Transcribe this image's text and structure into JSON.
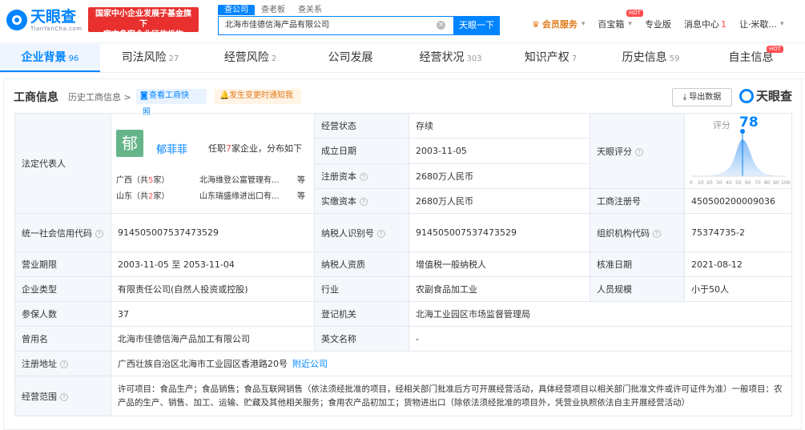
{
  "header": {
    "logo_name": "天眼查",
    "logo_sub": "TianYanCha.com",
    "red_badge_line1": "国家中小企业发展子基金旗下",
    "red_badge_line2": "官方备案企业征信机构",
    "search_tabs": [
      "查公司",
      "查老板",
      "查关系"
    ],
    "search_value": "北海市佳德信海产品有限公司",
    "search_button": "天眼一下",
    "nav": {
      "vip": "会员服务",
      "baibao": "百宝箱",
      "hot": "HOT",
      "pro": "专业版",
      "msg": "消息中心",
      "msg_count": "1",
      "user": "让·米歇..."
    }
  },
  "tabs": [
    {
      "label": "企业背景",
      "count": "96"
    },
    {
      "label": "司法风险",
      "count": "27"
    },
    {
      "label": "经营风险",
      "count": "2"
    },
    {
      "label": "公司发展",
      "count": ""
    },
    {
      "label": "经营状况",
      "count": "303"
    },
    {
      "label": "知识产权",
      "count": "7"
    },
    {
      "label": "历史信息",
      "count": "59"
    },
    {
      "label": "自主信息",
      "count": ""
    }
  ],
  "section": {
    "title": "工商信息",
    "history": "历史工商信息 >",
    "view_btn": "查看工商快",
    "view_btn2": "照",
    "notify_btn": "发生变更时通知我",
    "export_btn": "导出数据",
    "logo": "天眼查"
  },
  "legal_rep": {
    "label": "法定代表人",
    "avatar": "郁",
    "name": "郁菲菲",
    "pos_pre": "任职",
    "pos_num": "7",
    "pos_post": "家企业，分布如下",
    "r1_region": "广西（共",
    "r1_num": "5",
    "r1_unit": "家）",
    "r1_company": "北海维登公富管理有...",
    "r1_more": "等",
    "r2_region": "山东（共",
    "r2_num": "2",
    "r2_unit": "家）",
    "r2_company": "山东瑞盛缘进出口有...",
    "r2_more": "等"
  },
  "rows": {
    "status_label": "经营状态",
    "status": "存续",
    "found_label": "成立日期",
    "found": "2003-11-05",
    "reg_cap_label": "注册资本",
    "reg_cap": "2680万人民币",
    "paid_cap_label": "实缴资本",
    "paid_cap": "2680万人民币",
    "score_label": "天眼评分",
    "score_word": "评分",
    "score_value": "78",
    "score_ticks": [
      "0",
      "10",
      "20",
      "30",
      "40",
      "50",
      "60",
      "70",
      "80",
      "90",
      "100"
    ],
    "reg_no_label": "工商注册号",
    "reg_no": "450500200009036",
    "credit_label": "统一社会信用代码",
    "credit": "914505007537473529",
    "taxid_label": "纳税人识别号",
    "taxid": "914505007537473529",
    "org_label": "组织机构代码",
    "org": "75374735-2",
    "term_label": "营业期限",
    "term": "2003-11-05 至 2053-11-04",
    "taxq_label": "纳税人资质",
    "taxq": "增值税一般纳税人",
    "approve_label": "核准日期",
    "approve": "2021-08-12",
    "type_label": "企业类型",
    "type": "有限责任公司(自然人投资或控股)",
    "industry_label": "行业",
    "industry": "农副食品加工业",
    "staff_label": "人员规模",
    "staff": "小于50人",
    "insured_label": "参保人数",
    "insured": "37",
    "authority_label": "登记机关",
    "authority": "北海工业园区市场监督管理局",
    "former_label": "曾用名",
    "former": "北海市佳德信海产品加工有限公司",
    "en_label": "英文名称",
    "en": "-",
    "addr_label": "注册地址",
    "addr": "广西壮族自治区北海市工业园区香港路20号",
    "addr_link": "附近公司",
    "scope_label": "经营范围",
    "scope": "许可项目：食品生产；食品销售；食品互联网销售（依法须经批准的项目，经相关部门批准后方可开展经营活动，具体经营项目以相关部门批准文件或许可证件为准）一般项目：农产品的生产、销售、加工、运输、贮藏及其他相关服务；食用农产品初加工；货物进出口（除依法须经批准的项目外，凭营业执照依法自主开展经营活动）"
  },
  "colors": {
    "brand": "#0084ff",
    "red": "#e8312f",
    "label_bg": "#f4f7fb"
  }
}
